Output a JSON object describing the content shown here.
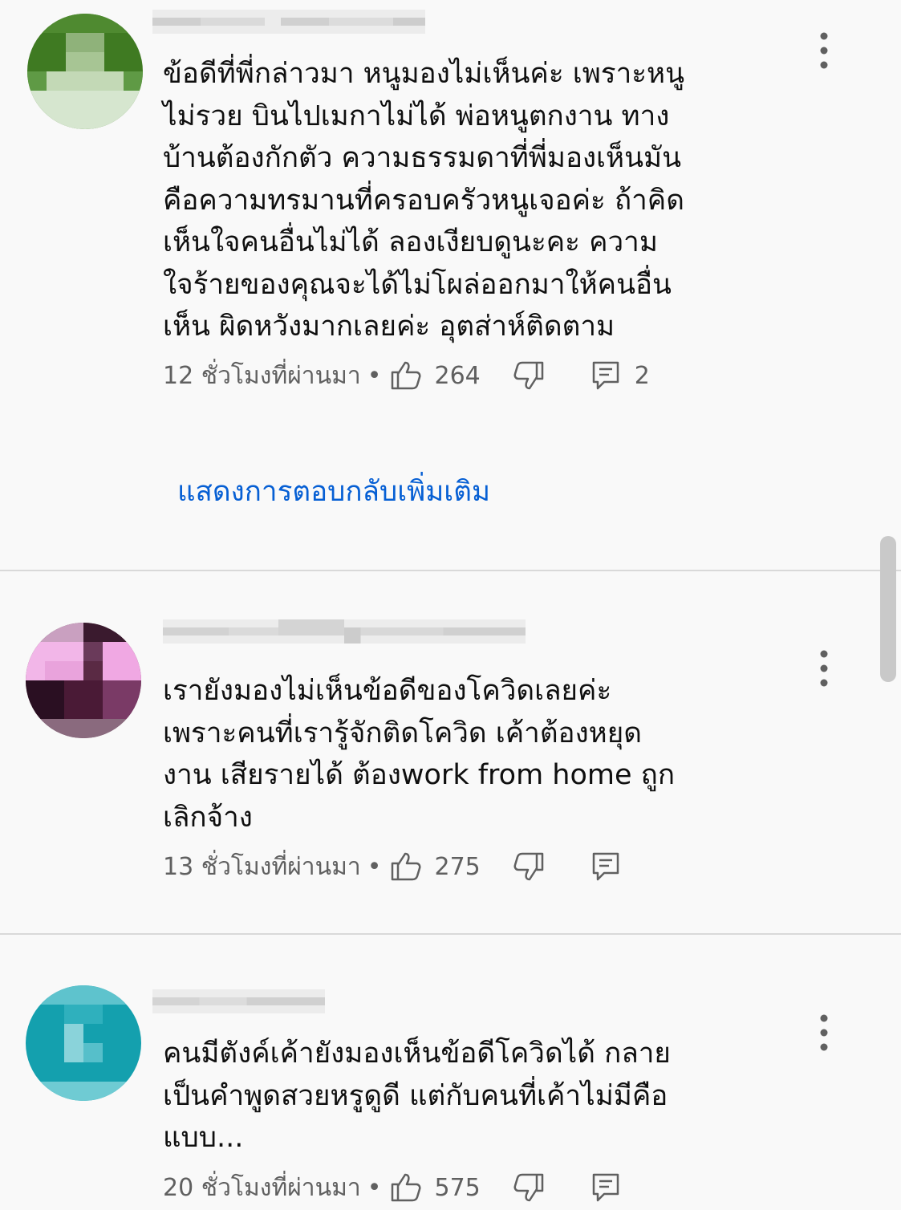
{
  "comments": [
    {
      "text": "ข้อดีที่พี่กล่าวมา หนูมองไม่เห็นค่ะ เพราะหนู\nไม่รวย บินไปเมกาไม่ได้ พ่อหนูตกงาน ทาง\nบ้านต้องกักตัว ความธรรมดาที่พี่มองเห็นมัน\nคือความทรมานที่ครอบครัวหนูเจอค่ะ ถ้าคิด\nเห็นใจคนอื่นไม่ได้ ลองเงียบดูนะคะ ความ\nใจร้ายของคุณจะได้ไม่โผล่ออกมาให้คนอื่น\nเห็น ผิดหวังมากเลยค่ะ อุตส่าห์ติดตาม",
      "time": "12 ชั่วโมงที่ผ่านมา",
      "likes": "264",
      "replies": "2",
      "avatar_color": "#3f7a22"
    },
    {
      "text": "เรายังมองไม่เห็นข้อดีของโควิดเลยค่ะ\nเพราะคนที่เรารู้จักติดโควิด เค้าต้องหยุด\nงาน เสียรายได้ ต้องwork from home ถูก\nเลิกจ้าง",
      "time": "13 ชั่วโมงที่ผ่านมา",
      "likes": "275",
      "replies": "",
      "avatar_color": "#e9a3dc"
    },
    {
      "text": "คนมีตังค์เค้ายังมองเห็นข้อดีโควิดได้ กลาย\nเป็นคำพูดสวยหรูดูดี แต่กับคนที่เค้าไม่มีคือ\nแบบ...",
      "time": "20 ชั่วโมงที่ผ่านมา",
      "likes": "575",
      "replies": "",
      "avatar_color": "#14a0ae"
    }
  ],
  "show_more_replies": "แสดงการตอบกลับเพิ่มเติม",
  "icons": {
    "like": "thumbs-up-icon",
    "dislike": "thumbs-down-icon",
    "reply": "reply-icon",
    "more": "more-vert-icon"
  }
}
